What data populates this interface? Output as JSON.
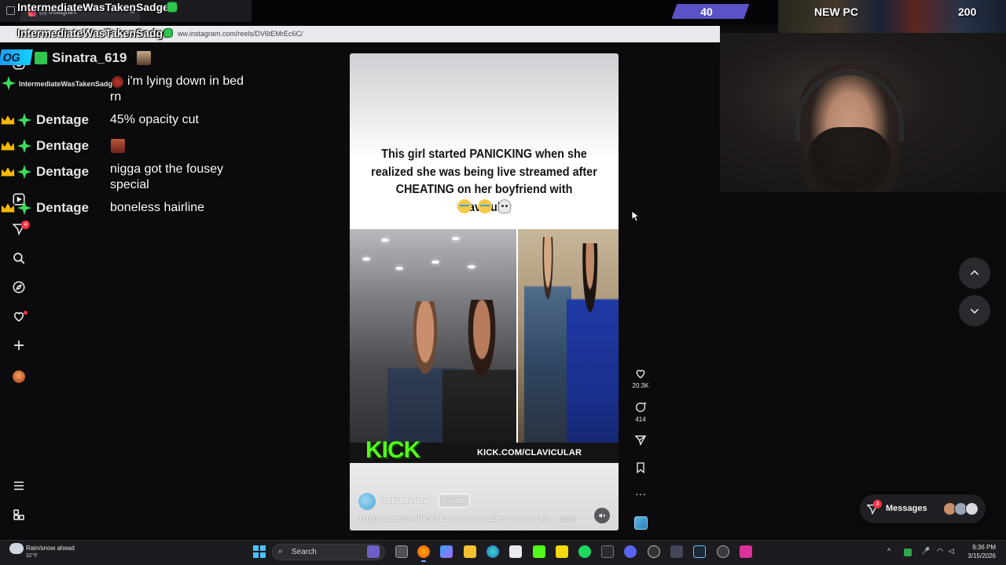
{
  "browser": {
    "tab_title": "(3) Instagram",
    "url": "ww.instagram.com/reels/DV6tEMrEc6C/"
  },
  "stream_overlay": {
    "username_top": "IntermediateWasTakenSadge",
    "username_url_row": "IntermediateWasTakenSadge",
    "counter_value": "40",
    "goal_label": "NEW PC",
    "goal_value": "200",
    "accent_purple": "#5b52c6"
  },
  "chat": {
    "messages": [
      {
        "user": "Sinatra_619",
        "badge": "OG",
        "text": ""
      },
      {
        "user": "IntermediateWasTakenSadg",
        "text": "i'm lying down in bed rn"
      },
      {
        "user": "Dentage",
        "text": "45% opacity cut"
      },
      {
        "user": "Dentage",
        "text": ""
      },
      {
        "user": "Dentage",
        "text": "nigga got the fousey special"
      },
      {
        "user": "Dentage",
        "text": "boneless hairline"
      }
    ],
    "crown_color": "#f5b700",
    "sparkle_color": "#3ddc5a"
  },
  "instagram": {
    "sidebar": {
      "icons": [
        "instagram-icon",
        "reels-icon",
        "send-icon",
        "search-icon",
        "explore-icon",
        "heart-icon",
        "create-icon",
        "profile-avatar",
        "menu-icon",
        "threads-icon"
      ],
      "notification_count": "4"
    },
    "reel": {
      "headline": "This girl started PANICKING when she realized she was being live streamed after CHEATING on her boyfriend with Clavicular",
      "kick_logo": "KICK",
      "kick_url": "KICK.COM/CLAVICULAR",
      "author": "justinteresting",
      "follow_label": "Follow",
      "caption": "This girl started PANICKING when she realized she was bein ...",
      "caption_more": "more"
    },
    "actions": {
      "likes": "20.3K",
      "comments": "414"
    },
    "messages": {
      "label": "Messages",
      "badge": "3"
    }
  },
  "taskbar": {
    "weather_title": "Rain/snow ahead",
    "weather_temp": "32°F",
    "search_label": "Search",
    "clock_time": "9:36 PM",
    "clock_date": "3/15/2026"
  }
}
